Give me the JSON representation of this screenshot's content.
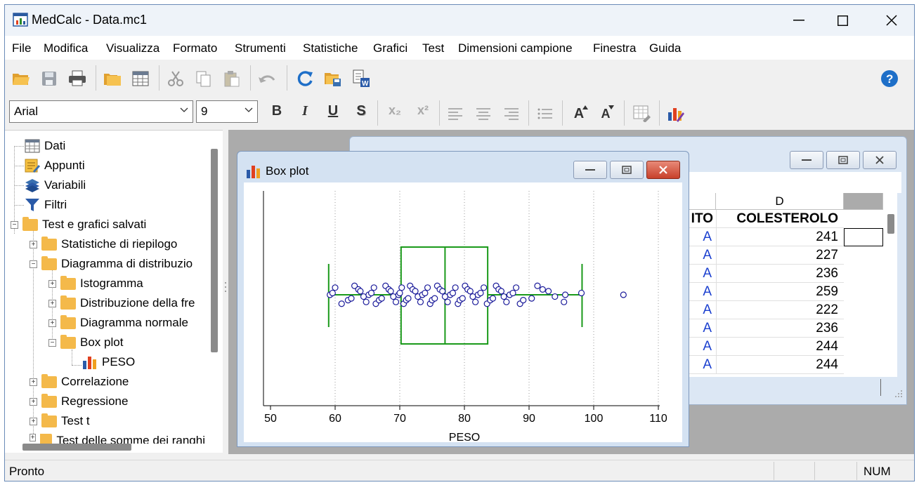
{
  "window": {
    "title": "MedCalc - Data.mc1"
  },
  "menu": [
    "File",
    "Modifica",
    "Visualizza",
    "Formato",
    "Strumenti",
    "Statistiche",
    "Grafici",
    "Test",
    "Dimensioni campione",
    "Finestra",
    "Guida"
  ],
  "toolbar": {
    "icons": [
      "open-icon",
      "save-icon",
      "print-icon",
      "copy-doc-icon",
      "spreadsheet-icon",
      "cut-icon",
      "copy-icon",
      "paste-icon",
      "undo-icon",
      "refresh-icon",
      "save-report-icon",
      "export-word-icon",
      "help-icon"
    ]
  },
  "format_bar": {
    "font": "Arial",
    "size": "9",
    "bold": "B",
    "italic": "I",
    "underline": "U",
    "shadow": "S",
    "subscript": "x₂",
    "superscript": "x²",
    "grow_font": "A",
    "shrink_font": "A"
  },
  "tree": {
    "items": [
      {
        "label": "Dati",
        "icon": "spreadsheet-icon"
      },
      {
        "label": "Appunti",
        "icon": "notes-icon"
      },
      {
        "label": "Variabili",
        "icon": "variables-icon"
      },
      {
        "label": "Filtri",
        "icon": "filter-icon"
      },
      {
        "label": "Test e grafici salvati",
        "icon": "folder-icon"
      },
      {
        "label": "Statistiche di riepilogo",
        "icon": "folder-icon"
      },
      {
        "label": "Diagramma di distribuzio",
        "icon": "folder-icon"
      },
      {
        "label": "Istogramma",
        "icon": "folder-icon"
      },
      {
        "label": "Distribuzione della fre",
        "icon": "folder-icon"
      },
      {
        "label": "Diagramma normale",
        "icon": "folder-icon"
      },
      {
        "label": "Box plot",
        "icon": "folder-icon"
      },
      {
        "label": "PESO",
        "icon": "chart-icon"
      },
      {
        "label": "Correlazione",
        "icon": "folder-icon"
      },
      {
        "label": "Regressione",
        "icon": "folder-icon"
      },
      {
        "label": "Test t",
        "icon": "folder-icon"
      },
      {
        "label": "Test delle somme dei ranghi",
        "icon": "folder-icon"
      }
    ]
  },
  "spreadsheet": {
    "col_c_header": "",
    "col_d_header": "D",
    "col_c_name": "ITO",
    "col_d_name": "COLESTEROLO",
    "rows": [
      {
        "c": "A",
        "d": "241"
      },
      {
        "c": "A",
        "d": "227"
      },
      {
        "c": "A",
        "d": "236"
      },
      {
        "c": "A",
        "d": "259"
      },
      {
        "c": "A",
        "d": "222"
      },
      {
        "c": "A",
        "d": "236"
      },
      {
        "c": "A",
        "d": "244"
      },
      {
        "c": "A",
        "d": "244"
      }
    ],
    "accent_color": "#1a3fcf"
  },
  "plot_window": {
    "title": "Box plot"
  },
  "chart_data": {
    "type": "box",
    "title": "",
    "xlabel": "PESO",
    "ylabel": "",
    "xlim": [
      50,
      110
    ],
    "xticks": [
      50,
      60,
      70,
      80,
      90,
      100,
      110
    ],
    "box": {
      "whisker_low": 59.0,
      "q1": 70.2,
      "median": 77.0,
      "q3": 83.6,
      "whisker_high": 98.2
    },
    "outliers": [
      104.6
    ],
    "points": [
      59.2,
      59.6,
      60.0,
      61.0,
      62.0,
      62.5,
      63.0,
      63.6,
      63.9,
      64.4,
      64.8,
      65.2,
      65.6,
      66.0,
      66.3,
      66.8,
      67.2,
      67.8,
      68.3,
      68.6,
      69.0,
      69.4,
      69.8,
      70.0,
      70.3,
      70.6,
      71.0,
      71.3,
      71.6,
      72.0,
      72.4,
      72.8,
      73.2,
      73.5,
      73.9,
      74.3,
      74.7,
      75.0,
      75.4,
      75.8,
      76.2,
      76.6,
      77.0,
      77.4,
      77.8,
      78.2,
      78.6,
      79.0,
      79.3,
      79.7,
      80.1,
      80.5,
      80.9,
      81.3,
      81.7,
      82.1,
      82.5,
      83.0,
      83.5,
      84.0,
      84.4,
      84.9,
      85.3,
      85.7,
      86.1,
      86.5,
      87.0,
      87.5,
      88.0,
      88.6,
      89.1,
      90.4,
      91.3,
      92.1,
      93.0,
      94.0,
      95.4,
      95.6,
      98.1
    ],
    "box_color": "#1a9a1a",
    "point_color": "#1a1a9a",
    "grid": "vertical dotted"
  },
  "status": {
    "left": "Pronto",
    "right": "NUM"
  }
}
